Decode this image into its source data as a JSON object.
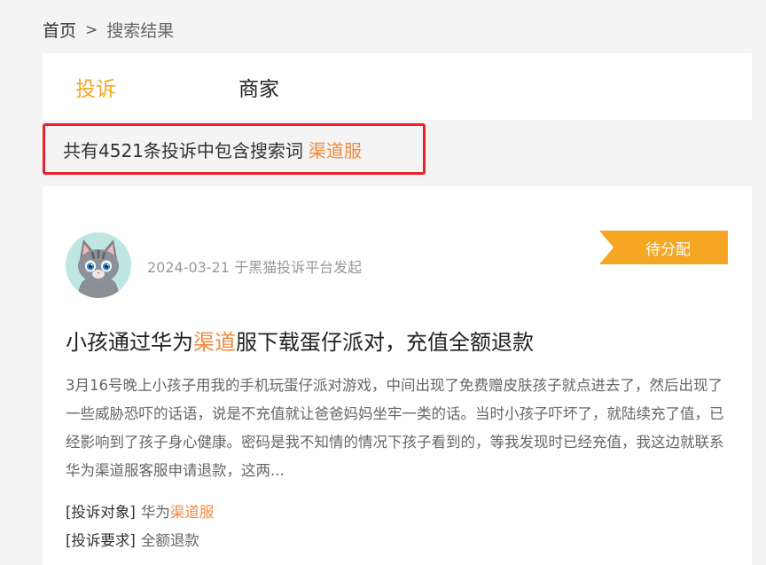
{
  "breadcrumb": {
    "home": "首页",
    "separator": ">",
    "current": "搜索结果"
  },
  "tabs": [
    {
      "label": "投诉",
      "active": true
    },
    {
      "label": "商家",
      "active": false
    }
  ],
  "summary": {
    "text": "共有4521条投诉中包含搜索词",
    "keyword": "渠道服"
  },
  "complaint": {
    "date_line": "2024-03-21 于黑猫投诉平台发起",
    "status": "待分配",
    "title_parts": [
      "小孩通过华为",
      "渠道",
      "服下载蛋仔派对，充值全额退款"
    ],
    "description": "3月16号晚上小孩子用我的手机玩蛋仔派对游戏，中间出现了免费赠皮肤孩子就点进去了，然后出现了一些威胁恐吓的话语，说是不充值就让爸爸妈妈坐牢一类的话。当时小孩子吓坏了，就陆续充了值，已经影响到了孩子身心健康。密码是我不知情的情况下孩子看到的，等我发现时已经充值，我这边就联系华为渠道服客服申请退款，这两...",
    "target_label": "[投诉对象]",
    "target_value_parts": [
      "华为",
      "渠道服"
    ],
    "request_label": "[投诉要求]",
    "request_value": "全额退款"
  },
  "colors": {
    "accent": "#f5a623",
    "highlight": "#f08a3e",
    "alert_border": "#e8222b"
  },
  "icons": {
    "avatar": "cat-avatar-icon"
  }
}
